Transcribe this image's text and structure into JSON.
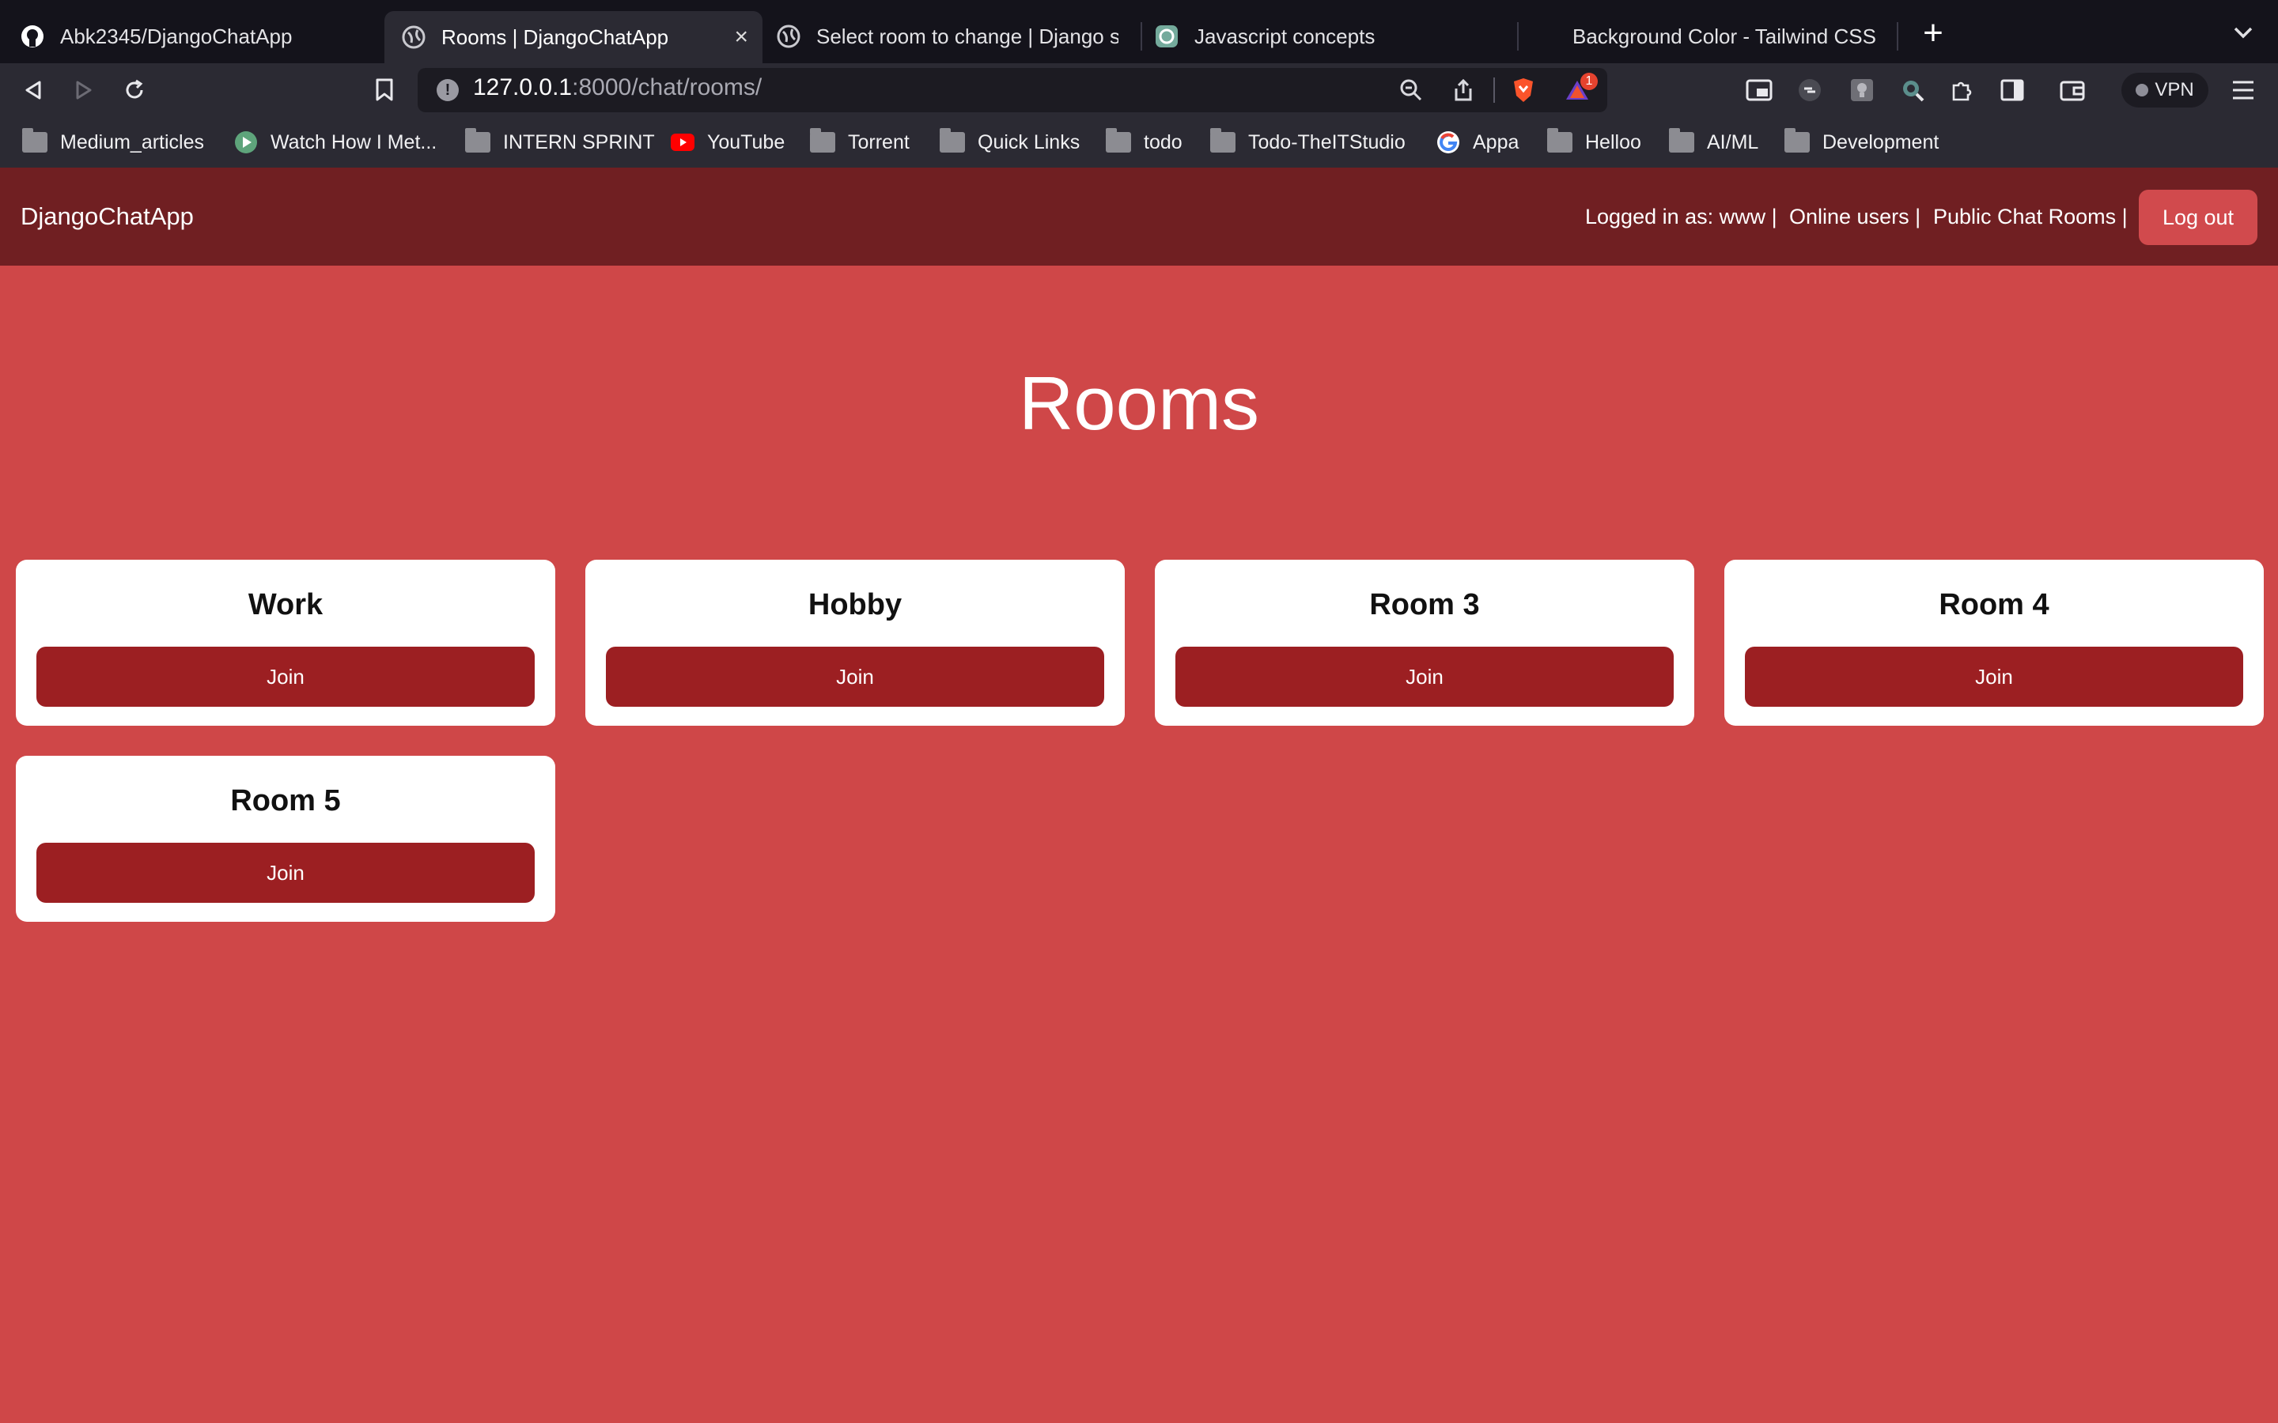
{
  "browser": {
    "tabs": [
      {
        "label": "Abk2345/DjangoChatApp",
        "icon": "github-icon"
      },
      {
        "label": "Rooms | DjangoChatApp",
        "icon": "globe-icon",
        "active": true
      },
      {
        "label": "Select room to change | Django site",
        "icon": "globe-icon"
      },
      {
        "label": "Javascript concepts",
        "icon": "chatgpt-icon"
      },
      {
        "label": "Background Color - Tailwind CSS",
        "icon": "tailwind-icon"
      }
    ],
    "url": {
      "host": "127.0.0.1",
      "rest": ":8000/chat/rooms/"
    },
    "brave_badge": "1",
    "vpn_label": "VPN",
    "bookmarks": [
      {
        "label": "Medium_articles",
        "icon": "folder-icon"
      },
      {
        "label": "Watch How I Met...",
        "icon": "play-icon"
      },
      {
        "label": "INTERN SPRINT",
        "icon": "folder-icon"
      },
      {
        "label": "YouTube",
        "icon": "youtube-icon"
      },
      {
        "label": "Torrent",
        "icon": "folder-icon"
      },
      {
        "label": "Quick Links",
        "icon": "folder-icon"
      },
      {
        "label": "todo",
        "icon": "folder-icon"
      },
      {
        "label": "Todo-TheITStudio",
        "icon": "folder-icon"
      },
      {
        "label": "Appa",
        "icon": "google-icon"
      },
      {
        "label": "Helloo",
        "icon": "folder-icon"
      },
      {
        "label": "AI/ML",
        "icon": "folder-icon"
      },
      {
        "label": "Development",
        "icon": "folder-icon"
      }
    ]
  },
  "app": {
    "brand": "DjangoChatApp",
    "nav": {
      "logged_in": "Logged in as: www |",
      "online_users": "Online users |",
      "public_rooms": "Public Chat Rooms |",
      "logout": "Log out"
    },
    "page_title": "Rooms",
    "rooms": [
      {
        "name": "Work",
        "button": "Join"
      },
      {
        "name": "Hobby",
        "button": "Join"
      },
      {
        "name": "Room 3",
        "button": "Join"
      },
      {
        "name": "Room 4",
        "button": "Join"
      },
      {
        "name": "Room 5",
        "button": "Join"
      }
    ],
    "colors": {
      "page_bg": "#cf4748",
      "nav_bg": "#701f22",
      "button": "#9c1f22",
      "logout_bg": "#d14a4d"
    }
  }
}
